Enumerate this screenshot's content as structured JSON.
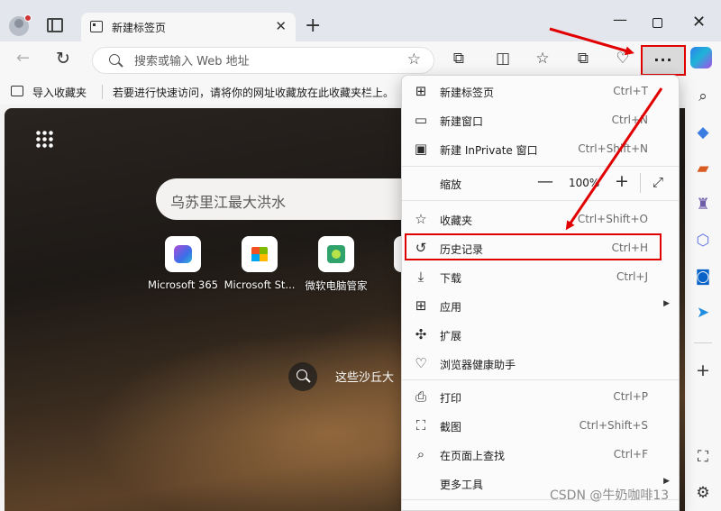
{
  "tab": {
    "title": "新建标签页"
  },
  "address_bar": {
    "placeholder": "搜索或输入 Web 地址"
  },
  "favorites_bar": {
    "import_label": "导入收藏夹",
    "hint": "若要进行快速访问，请将你的网址收藏放在此收藏夹栏上。"
  },
  "new_tab_page": {
    "search_query": "乌苏里江最大洪水",
    "shortcuts": [
      {
        "label": "Microsoft 365"
      },
      {
        "label": "Microsoft St..."
      },
      {
        "label": "微软电脑管家"
      }
    ],
    "story_text": "这些沙丘大"
  },
  "menu": {
    "items": [
      {
        "label": "新建标签页",
        "shortcut": "Ctrl+T",
        "icon": "new-tab-icon"
      },
      {
        "label": "新建窗口",
        "shortcut": "Ctrl+N",
        "icon": "new-window-icon"
      },
      {
        "label": "新建 InPrivate 窗口",
        "shortcut": "Ctrl+Shift+N",
        "icon": "inprivate-icon"
      },
      {
        "label": "缩放",
        "icon": ""
      },
      {
        "label": "收藏夹",
        "shortcut": "Ctrl+Shift+O",
        "icon": "favorites-icon"
      },
      {
        "label": "历史记录",
        "shortcut": "Ctrl+H",
        "icon": "history-icon"
      },
      {
        "label": "下载",
        "shortcut": "Ctrl+J",
        "icon": "download-icon"
      },
      {
        "label": "应用",
        "icon": "apps-icon"
      },
      {
        "label": "扩展",
        "icon": "extensions-icon"
      },
      {
        "label": "浏览器健康助手",
        "icon": "browser-health-icon"
      },
      {
        "label": "打印",
        "shortcut": "Ctrl+P",
        "icon": "print-icon"
      },
      {
        "label": "截图",
        "shortcut": "Ctrl+Shift+S",
        "icon": "screenshot-icon"
      },
      {
        "label": "在页面上查找",
        "shortcut": "Ctrl+F",
        "icon": "find-icon"
      },
      {
        "label": "更多工具",
        "icon": ""
      }
    ],
    "zoom_value": "100%"
  },
  "annotation": {
    "color": "#e00000"
  },
  "watermark": "CSDN @牛奶咖啡13"
}
